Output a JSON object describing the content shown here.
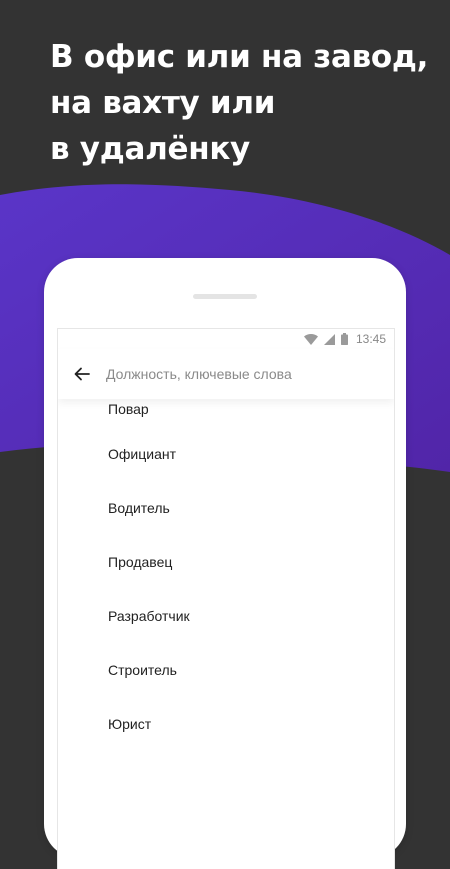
{
  "headline": {
    "lines": [
      "В офис или на завод,",
      "на вахту или",
      "в удалёнку"
    ]
  },
  "status_bar": {
    "time": "13:45"
  },
  "search": {
    "placeholder": "Должность, ключевые слова"
  },
  "suggestions": [
    "Повар",
    "Официант",
    "Водитель",
    "Продавец",
    "Разработчик",
    "Строитель",
    "Юрист"
  ],
  "colors": {
    "background": "#333333",
    "wave": "#5b2fc0",
    "phone": "#ffffff"
  }
}
